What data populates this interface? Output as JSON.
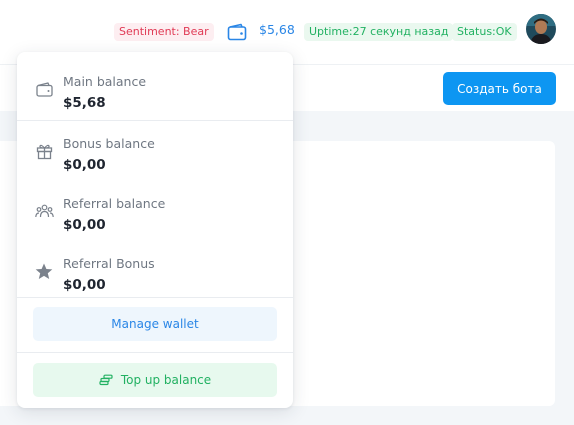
{
  "header": {
    "sentiment": "Sentiment: Bear",
    "balance": "$5,68",
    "uptime": "Uptime:27 секунд назад",
    "status": "Status:OK",
    "accent_color": "#0d96f2",
    "icons": [
      "wallet-icon",
      "avatar"
    ]
  },
  "subheader": {
    "create_bot_label": "Создать бота"
  },
  "wallet_dropdown": {
    "items": [
      {
        "label": "Main balance",
        "value": "$5,68",
        "icon": "wallet-icon"
      },
      {
        "label": "Bonus balance",
        "value": "$0,00",
        "icon": "gift-icon"
      },
      {
        "label": "Referral balance",
        "value": "$0,00",
        "icon": "users-icon"
      },
      {
        "label": "Referral Bonus",
        "value": "$0,00",
        "icon": "star-icon"
      }
    ],
    "manage_label": "Manage wallet",
    "topup_label": "Top up balance",
    "topup_icon": "coins-icon"
  }
}
